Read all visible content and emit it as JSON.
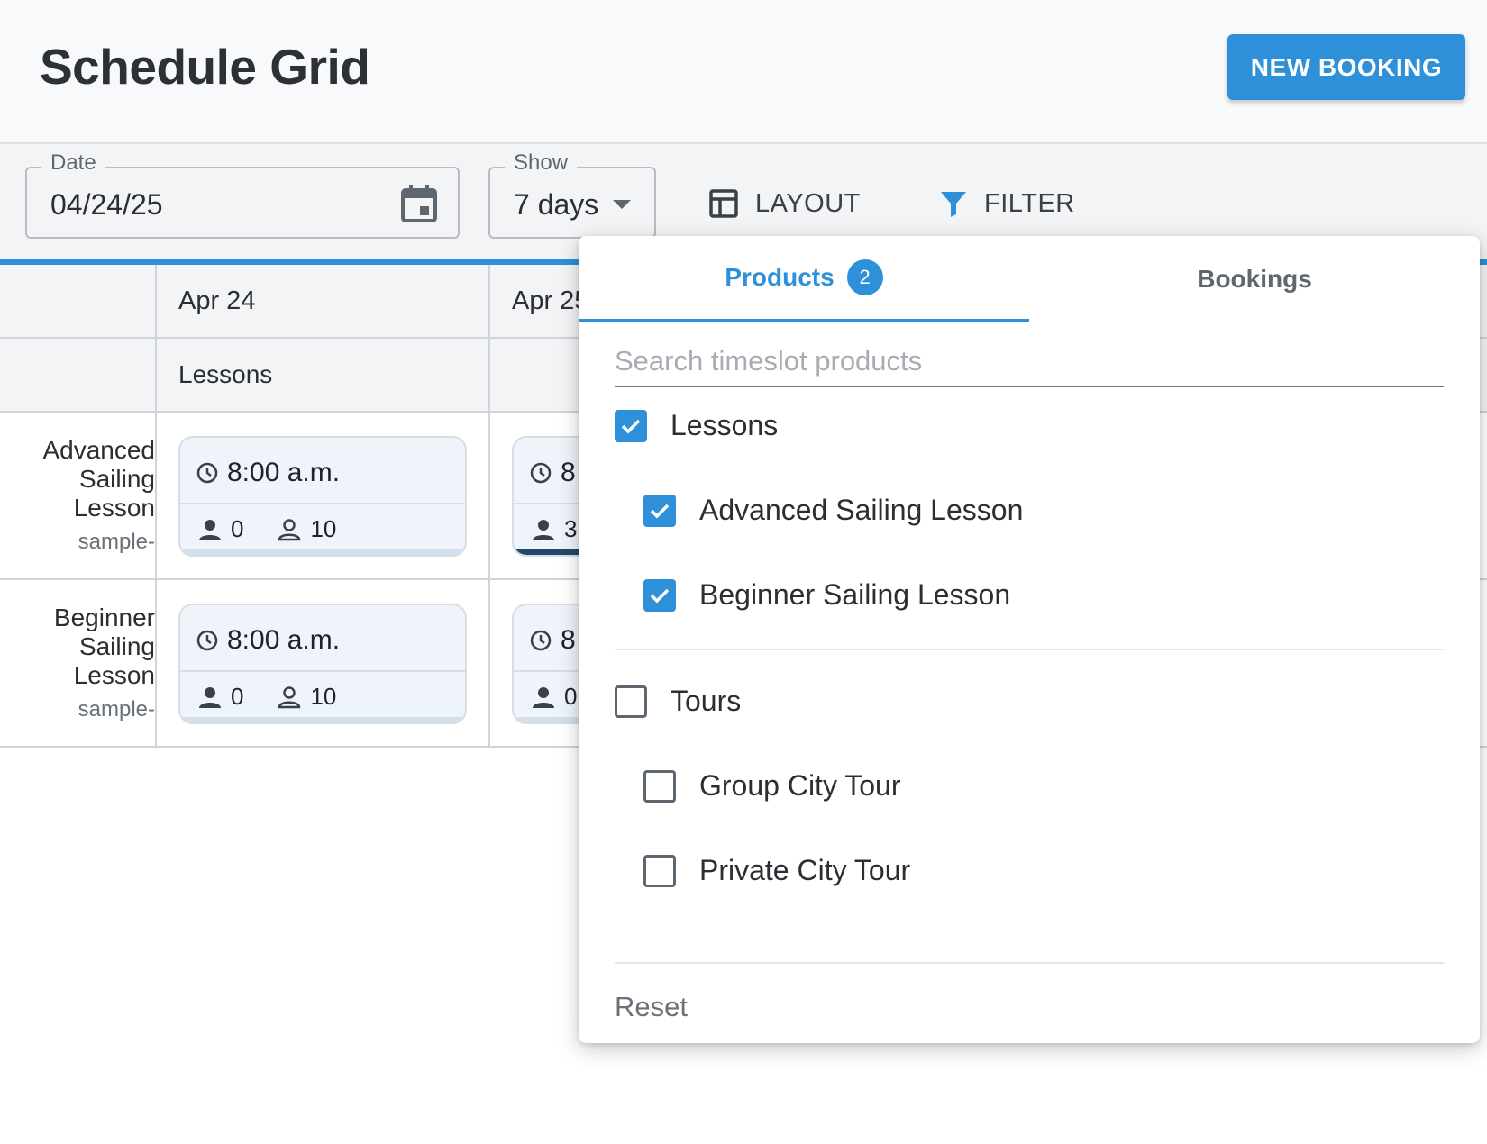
{
  "header": {
    "title": "Schedule Grid",
    "new_booking_label": "NEW BOOKING"
  },
  "toolbar": {
    "date": {
      "label": "Date",
      "value": "04/24/25",
      "icon": "calendar-icon"
    },
    "show": {
      "label": "Show",
      "value": "7 days"
    },
    "layout_label": "LAYOUT",
    "filter_label": "FILTER"
  },
  "grid": {
    "days": [
      "Apr 24",
      "Apr 25"
    ],
    "group": "Lessons",
    "rows": [
      {
        "name_lines": [
          "Advanced",
          "Sailing",
          "Lesson"
        ],
        "sub": "sample-",
        "slots": [
          {
            "time": "8:00 a.m.",
            "booked": "0",
            "capacity": "10"
          },
          {
            "time": "8",
            "booked": "3",
            "capacity": ""
          }
        ]
      },
      {
        "name_lines": [
          "Beginner",
          "Sailing",
          "Lesson"
        ],
        "sub": "sample-",
        "slots": [
          {
            "time": "8:00 a.m.",
            "booked": "0",
            "capacity": "10"
          },
          {
            "time": "8",
            "booked": "0",
            "capacity": ""
          }
        ]
      }
    ]
  },
  "filter_panel": {
    "tabs": [
      {
        "label": "Products",
        "badge": "2",
        "active": true
      },
      {
        "label": "Bookings",
        "active": false
      }
    ],
    "search_placeholder": "Search timeslot products",
    "groups": [
      {
        "label": "Lessons",
        "checked": true,
        "items": [
          {
            "label": "Advanced Sailing Lesson",
            "checked": true
          },
          {
            "label": "Beginner Sailing Lesson",
            "checked": true
          }
        ]
      },
      {
        "label": "Tours",
        "checked": false,
        "items": [
          {
            "label": "Group City Tour",
            "checked": false
          },
          {
            "label": "Private City Tour",
            "checked": false
          }
        ]
      }
    ],
    "reset_label": "Reset"
  },
  "colors": {
    "accent": "#2e90d8",
    "slot_bg": "#eef4fa",
    "slot_bar_dark": "#22496b"
  }
}
